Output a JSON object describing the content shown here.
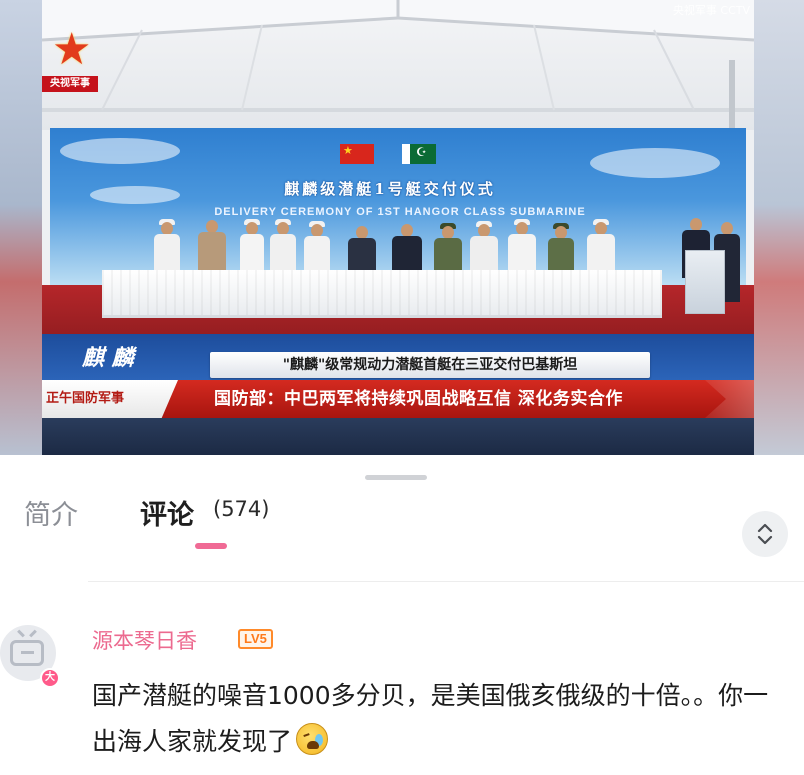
{
  "video": {
    "channel_logo_label": "央视军事",
    "watermark": "央视军事 CCTV",
    "backdrop_title": "麒麟级潜艇1号艇交付仪式",
    "backdrop_subtitle": "DELIVERY CEREMONY OF 1ST HANGOR CLASS SUBMARINE",
    "stage_band_left": "麒 麟",
    "lower_third_title": "\"麒麟\"级常规动力潜艇首艇在三亚交付巴基斯坦",
    "program_name": "正午国防军事",
    "headline": "国防部：中巴两军将持续巩固战略互信 深化务实合作"
  },
  "tabs": {
    "intro_label": "简介",
    "comments_label": "评论",
    "comments_count": "(574)"
  },
  "comment": {
    "username": "源本琴日香",
    "level": "LV5",
    "avatar_badge": "大",
    "text": "国产潜艇的噪音1000多分贝，是美国俄亥俄级的十倍。。你一出海人家就发现了"
  },
  "colors": {
    "accent_pink": "#f06a95",
    "username_pink": "#ec6a8f",
    "level_orange": "#ff7a1a",
    "news_red": "#c41e16"
  },
  "icons": {
    "sort": "chevron-up-down-icon",
    "emoji": "crying-laughing-emoji-icon"
  }
}
